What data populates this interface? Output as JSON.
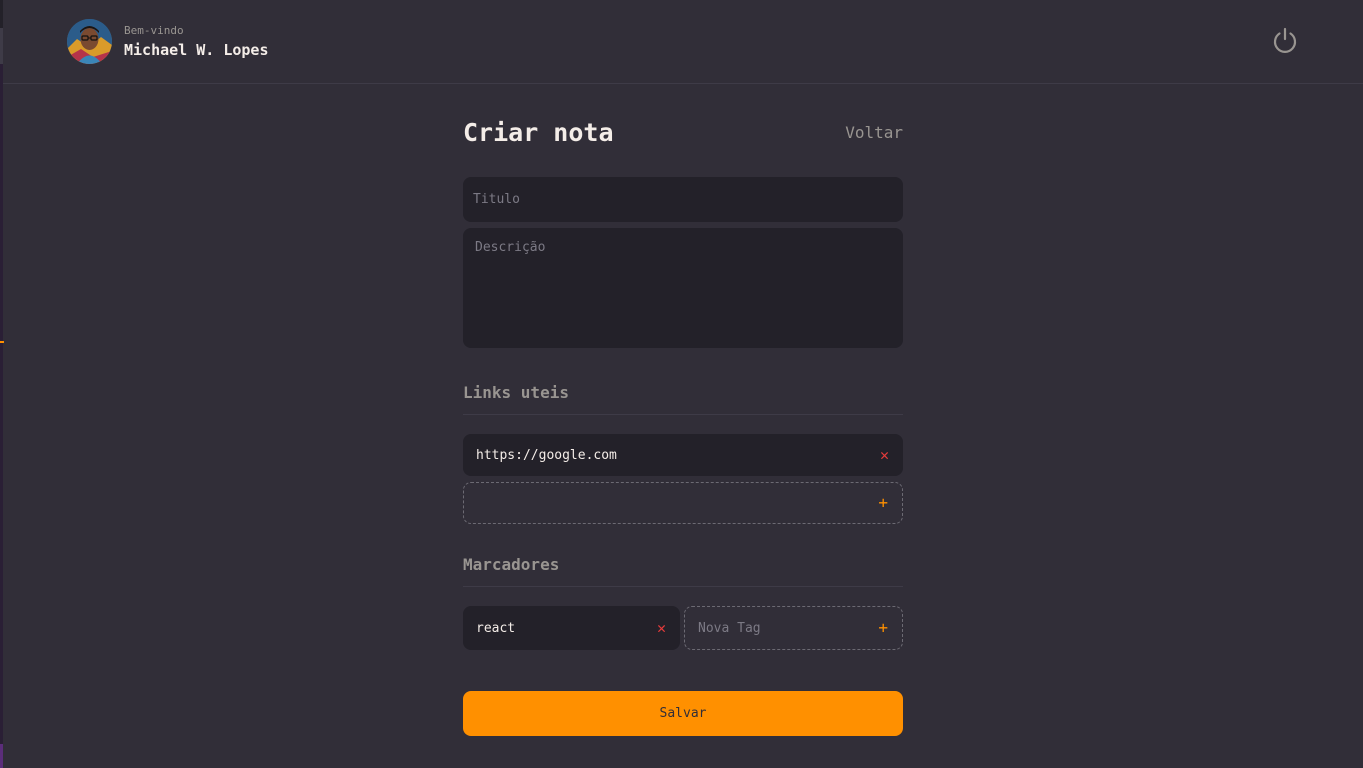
{
  "header": {
    "welcome": "Bem-vindo",
    "username": "Michael W. Lopes",
    "avatar_icon": "user-avatar",
    "logout_icon": "power-icon"
  },
  "form": {
    "title": "Criar nota",
    "back_label": "Voltar",
    "title_placeholder": "Titulo",
    "description_placeholder": "Descrição"
  },
  "links": {
    "section_title": "Links uteis",
    "items": [
      "https://google.com"
    ],
    "new_placeholder": ""
  },
  "tags": {
    "section_title": "Marcadores",
    "items": [
      "react"
    ],
    "new_placeholder": "Nova Tag"
  },
  "actions": {
    "remove_symbol": "✕",
    "add_symbol": "+",
    "save_label": "Salvar"
  },
  "colors": {
    "background": "#312e38",
    "input_background": "#232129",
    "accent": "#ff9000",
    "remove": "#e53b3b",
    "muted_text": "#999591"
  }
}
